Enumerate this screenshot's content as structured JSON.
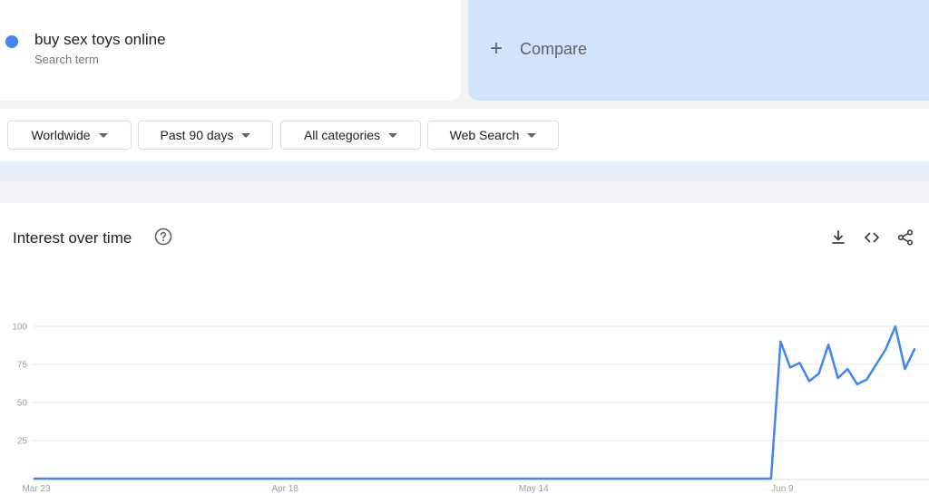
{
  "search_term": {
    "name": "buy sex toys online",
    "subtitle": "Search term",
    "color": "#4285f4"
  },
  "compare": {
    "icon": "plus-icon",
    "label": "Compare"
  },
  "filters": [
    {
      "label": "Worldwide"
    },
    {
      "label": "Past 90 days"
    },
    {
      "label": "All categories"
    },
    {
      "label": "Web Search"
    }
  ],
  "panel": {
    "title": "Interest over time",
    "help_icon": "help-circle-icon",
    "actions": [
      "download-icon",
      "embed-code-icon",
      "share-icon"
    ]
  },
  "chart_data": {
    "type": "line",
    "title": "",
    "xlabel": "",
    "ylabel": "",
    "ylim": [
      0,
      100
    ],
    "yticks": [
      25,
      50,
      75,
      100
    ],
    "grid": true,
    "x_tick_labels": [
      {
        "label": "Mar 23",
        "index": 0
      },
      {
        "label": "Apr 18",
        "index": 26
      },
      {
        "label": "May 14",
        "index": 52
      },
      {
        "label": "Jun 9",
        "index": 78
      }
    ],
    "series": [
      {
        "color": "#4285f4",
        "values": [
          0,
          0,
          0,
          0,
          0,
          0,
          0,
          0,
          0,
          0,
          0,
          0,
          0,
          0,
          0,
          0,
          0,
          0,
          0,
          0,
          0,
          0,
          0,
          0,
          0,
          0,
          0,
          0,
          0,
          0,
          0,
          0,
          0,
          0,
          0,
          0,
          0,
          0,
          0,
          0,
          0,
          0,
          0,
          0,
          0,
          0,
          0,
          0,
          0,
          0,
          0,
          0,
          0,
          0,
          0,
          0,
          0,
          0,
          0,
          0,
          0,
          0,
          0,
          0,
          0,
          0,
          0,
          0,
          0,
          0,
          0,
          0,
          0,
          0,
          0,
          0,
          0,
          0,
          90,
          73,
          76,
          64,
          69,
          88,
          66,
          72,
          62,
          65,
          75,
          85,
          100,
          72,
          85
        ]
      }
    ]
  }
}
